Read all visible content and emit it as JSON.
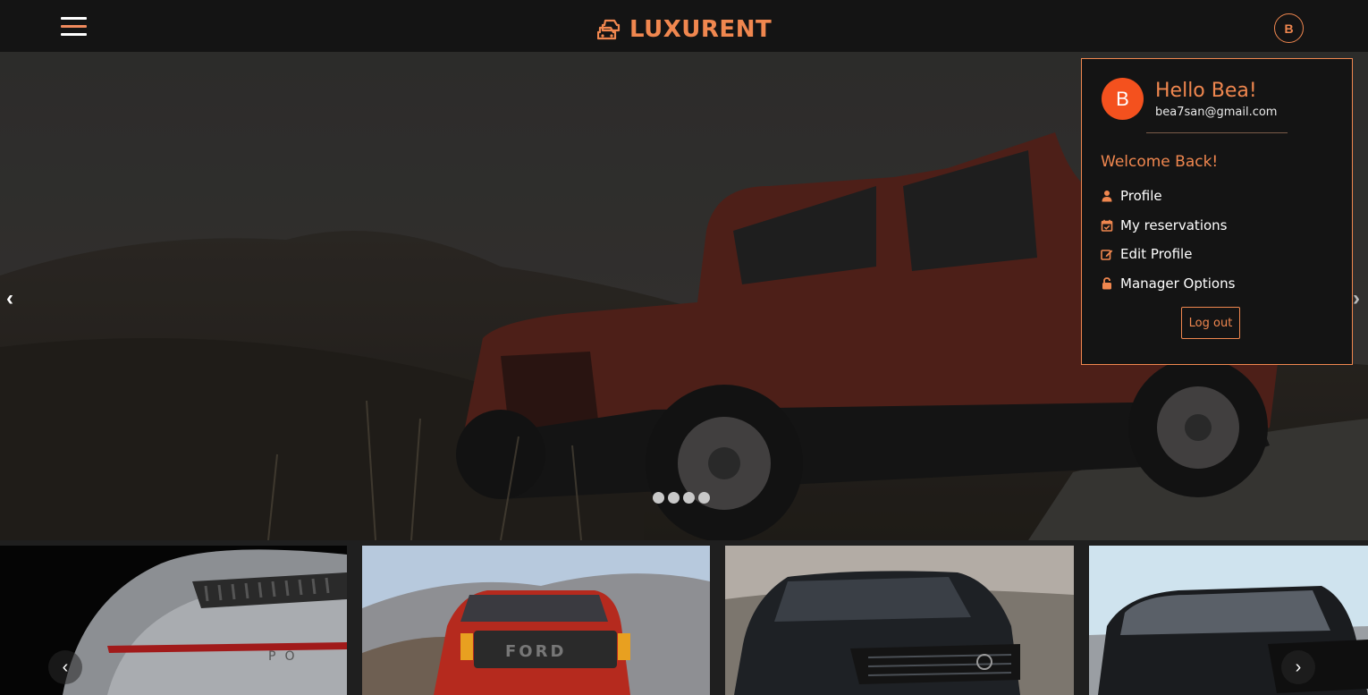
{
  "brand": {
    "name": "LUXURENT",
    "accent_color": "#f0874f",
    "icon": "car-stack-icon"
  },
  "navbar": {
    "menu_icon": "hamburger-icon",
    "user_initial": "B"
  },
  "hero": {
    "prev_label": "‹",
    "next_label": "›",
    "slide_count": 4,
    "active_slide": 1
  },
  "user_menu": {
    "initial": "B",
    "greeting": "Hello Bea!",
    "email": "bea7san@gmail.com",
    "welcome": "Welcome Back!",
    "items": [
      {
        "label": "Profile",
        "icon": "user-icon"
      },
      {
        "label": "My reservations",
        "icon": "calendar-check-icon"
      },
      {
        "label": "Edit Profile",
        "icon": "edit-icon"
      },
      {
        "label": "Manager Options",
        "icon": "unlock-icon"
      }
    ],
    "logout_label": "Log out"
  },
  "car_strip": {
    "prev_label": "‹",
    "next_label": "›",
    "cards": [
      {
        "alt": "silver sports car rear"
      },
      {
        "alt": "red pickup truck"
      },
      {
        "alt": "black SUV"
      },
      {
        "alt": "black luxury SUV"
      }
    ]
  }
}
